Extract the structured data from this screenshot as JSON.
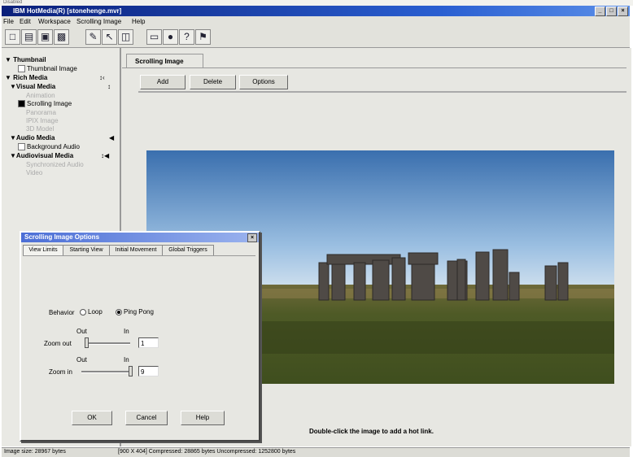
{
  "window": {
    "title": "IBM HotMedia(R) [stonehenge.mvr]",
    "corner_text": "Disabled"
  },
  "menu": [
    "File",
    "Edit",
    "Workspace",
    "Scrolling Image",
    "Help"
  ],
  "toolbar_icons": [
    "new-doc",
    "open-folder",
    "open",
    "save",
    "walk",
    "pointer",
    "split-view",
    "monitor",
    "record",
    "help",
    "flag"
  ],
  "tree": [
    {
      "label": "Thumbnail",
      "type": "header"
    },
    {
      "label": "Thumbnail Image",
      "type": "check"
    },
    {
      "label": "Rich Media",
      "type": "header"
    },
    {
      "label": "Visual Media",
      "type": "header"
    },
    {
      "label": "Animation",
      "type": "disabled"
    },
    {
      "label": "Scrolling Image",
      "type": "check-selected"
    },
    {
      "label": "Panorama",
      "type": "disabled"
    },
    {
      "label": "IPIX Image",
      "type": "disabled"
    },
    {
      "label": "3D Model",
      "type": "disabled"
    },
    {
      "label": "Audio Media",
      "type": "header"
    },
    {
      "label": "Background Audio",
      "type": "check"
    },
    {
      "label": "Audiovisual Media",
      "type": "header"
    },
    {
      "label": "Synchronized Audio",
      "type": "disabled"
    },
    {
      "label": "Video",
      "type": "disabled"
    }
  ],
  "main": {
    "tab_label": "Scrolling Image",
    "buttons": {
      "add": "Add",
      "delete": "Delete",
      "options": "Options"
    },
    "hint": "Double-click the image to add a hot link."
  },
  "dialog": {
    "title": "Scrolling Image Options",
    "tabs": [
      "View Limits",
      "Starting View",
      "Initial Movement",
      "Global Triggers"
    ],
    "behavior_label": "Behavior",
    "loop_label": "Loop",
    "pingpong_label": "Ping Pong",
    "behavior_selected": "Ping Pong",
    "out_label": "Out",
    "in_label": "In",
    "zoom_out_label": "Zoom out",
    "zoom_out_value": "1",
    "zoom_in_label": "Zoom in",
    "zoom_in_value": "9",
    "ok": "OK",
    "cancel": "Cancel",
    "help": "Help"
  },
  "status": {
    "size": "Image size: 28967 bytes",
    "details": "[900 X 404]  Compressed: 28865 bytes  Uncompressed: 1252800 bytes"
  }
}
